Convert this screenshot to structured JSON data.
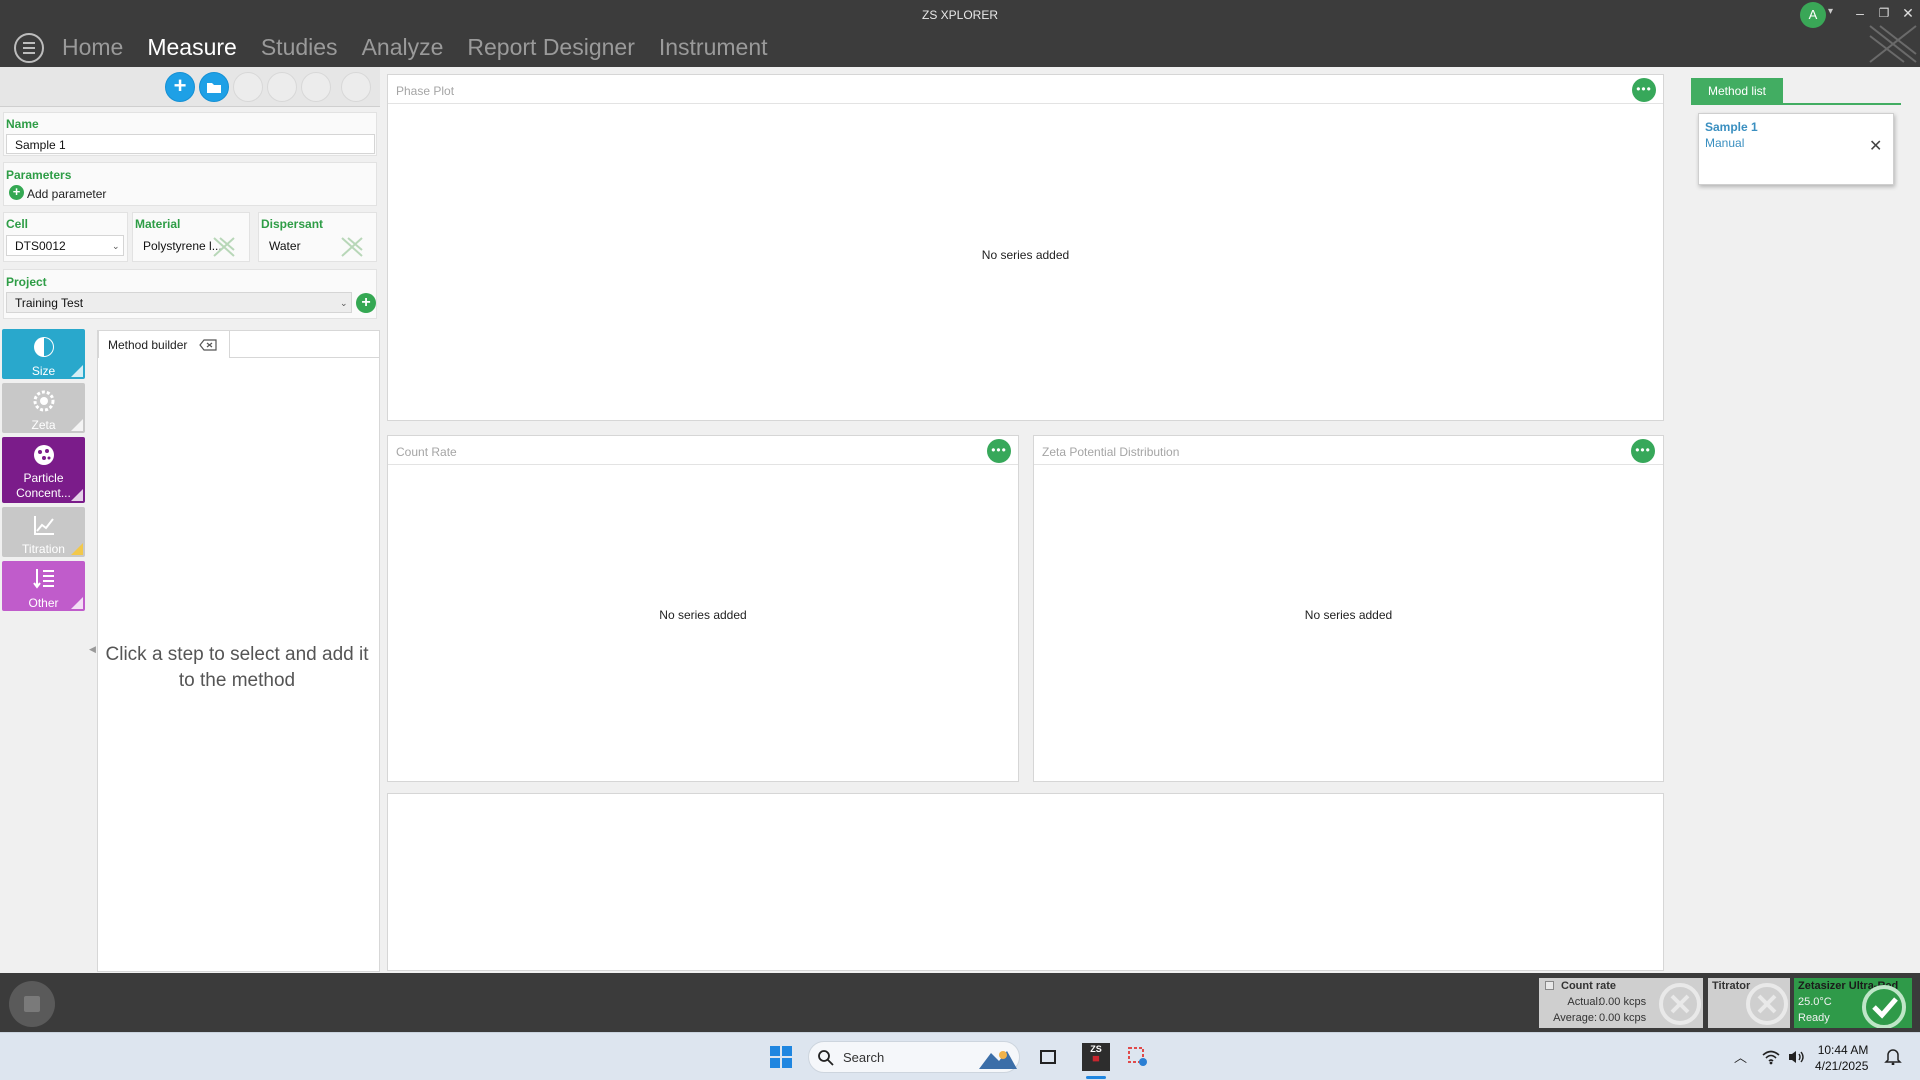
{
  "window": {
    "title": "ZS XPLORER",
    "user_initial": "A"
  },
  "nav": {
    "items": [
      "Home",
      "Measure",
      "Studies",
      "Analyze",
      "Report Designer",
      "Instrument"
    ],
    "active": "Measure"
  },
  "sample": {
    "name_label": "Name",
    "name_value": "Sample 1",
    "parameters_label": "Parameters",
    "add_parameter_label": "Add parameter",
    "cell_label": "Cell",
    "cell_value": "DTS0012",
    "material_label": "Material",
    "material_value": "Polystyrene l...",
    "dispersant_label": "Dispersant",
    "dispersant_value": "Water",
    "project_label": "Project",
    "project_value": "Training Test"
  },
  "method_tiles": [
    {
      "label": "Size",
      "icon": "size-icon",
      "color": "#29a8cc",
      "enabled": true
    },
    {
      "label": "Zeta",
      "icon": "zeta-icon",
      "color": "#c8c8c8",
      "enabled": false
    },
    {
      "label": "Particle Concent...",
      "icon": "particle-concentration-icon",
      "color": "#7b1c8a",
      "enabled": true
    },
    {
      "label": "Titration",
      "icon": "titration-icon",
      "color": "#c8c8c8",
      "enabled": false
    },
    {
      "label": "Other",
      "icon": "other-icon",
      "color": "#c05ccb",
      "enabled": true
    }
  ],
  "method_builder": {
    "tab_label": "Method builder",
    "placeholder": "Click a step to select and add it to the method"
  },
  "charts": {
    "phase_plot": {
      "title": "Phase Plot",
      "empty": "No series added"
    },
    "count_rate": {
      "title": "Count Rate",
      "empty": "No series added"
    },
    "zeta_distribution": {
      "title": "Zeta Potential Distribution",
      "empty": "No series added"
    }
  },
  "method_list": {
    "tab_label": "Method list",
    "items": [
      {
        "name": "Sample 1",
        "mode": "Manual"
      }
    ]
  },
  "status": {
    "count_rate": {
      "title": "Count rate",
      "actual_label": "Actual:",
      "actual_value": "0.00 kcps",
      "average_label": "Average:",
      "average_value": "0.00 kcps"
    },
    "titrator": {
      "title": "Titrator"
    },
    "instrument": {
      "title": "Zetasizer Ultra-Red",
      "temperature": "25.0°C",
      "state": "Ready",
      "color": "#2f9a49"
    }
  },
  "taskbar": {
    "search_label": "Search",
    "time": "10:44 AM",
    "date": "4/21/2025"
  }
}
